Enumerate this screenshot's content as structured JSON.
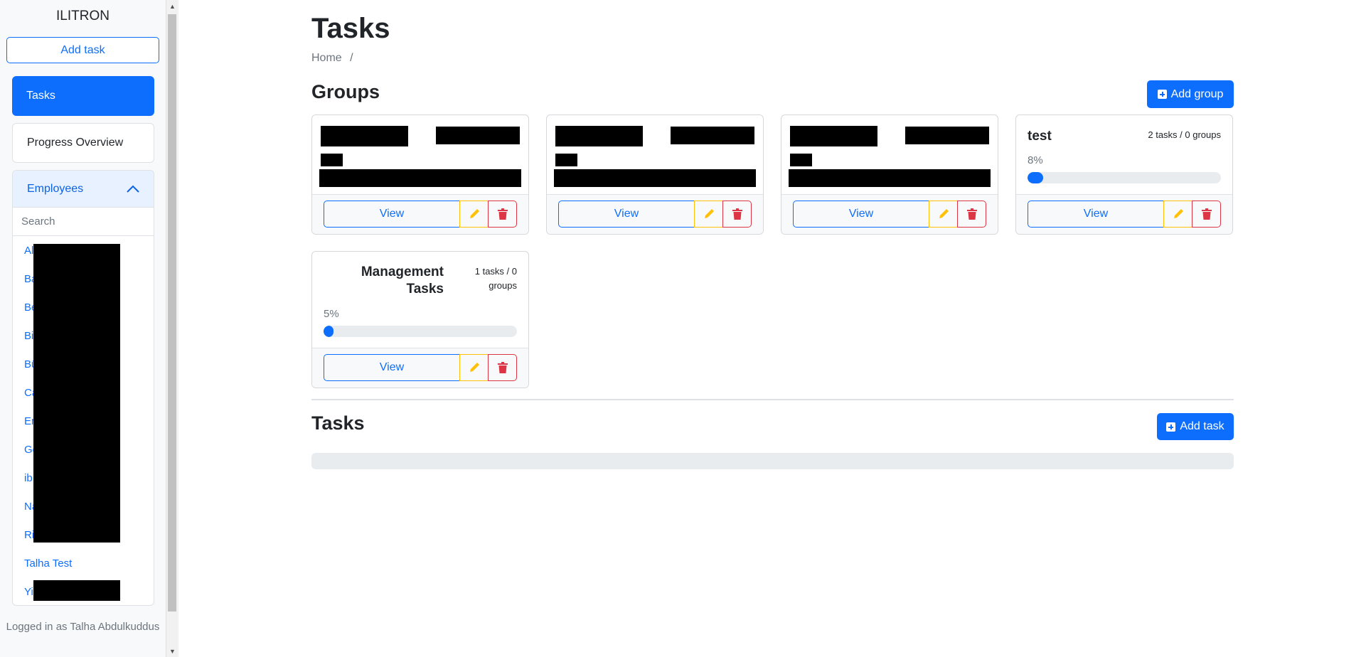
{
  "sidebar": {
    "brand": "ILITRON",
    "add_task_label": "Add task",
    "nav": [
      {
        "label": "Tasks",
        "active": true
      },
      {
        "label": "Progress Overview",
        "active": false
      }
    ],
    "employees": {
      "header": "Employees",
      "search_placeholder": "Search",
      "items": [
        "Al",
        "Ba",
        "Be",
        "Bi",
        "Bü",
        "Ca",
        "Er",
        "Gö",
        "ib",
        "Na",
        "Ri",
        "Talha Test",
        "Yi"
      ]
    },
    "logged_in": "Logged in as Talha Abdulkuddus"
  },
  "main": {
    "title": "Tasks",
    "breadcrumb": [
      "Home",
      "/"
    ],
    "groups_title": "Groups",
    "add_group_label": "Add group",
    "tasks_title": "Tasks",
    "add_task_label": "Add task",
    "card_view_label": "View",
    "groups": [
      {
        "title": "test",
        "meta": "2 tasks / 0 groups",
        "percent_label": "8%",
        "progress": 0.08
      },
      {
        "title": "Management Tasks",
        "meta": "1 tasks / 0 groups",
        "percent_label": "5%",
        "progress": 0.05
      }
    ]
  },
  "colors": {
    "primary": "#0d6efd",
    "warning": "#ffc107",
    "danger": "#dc3545"
  }
}
